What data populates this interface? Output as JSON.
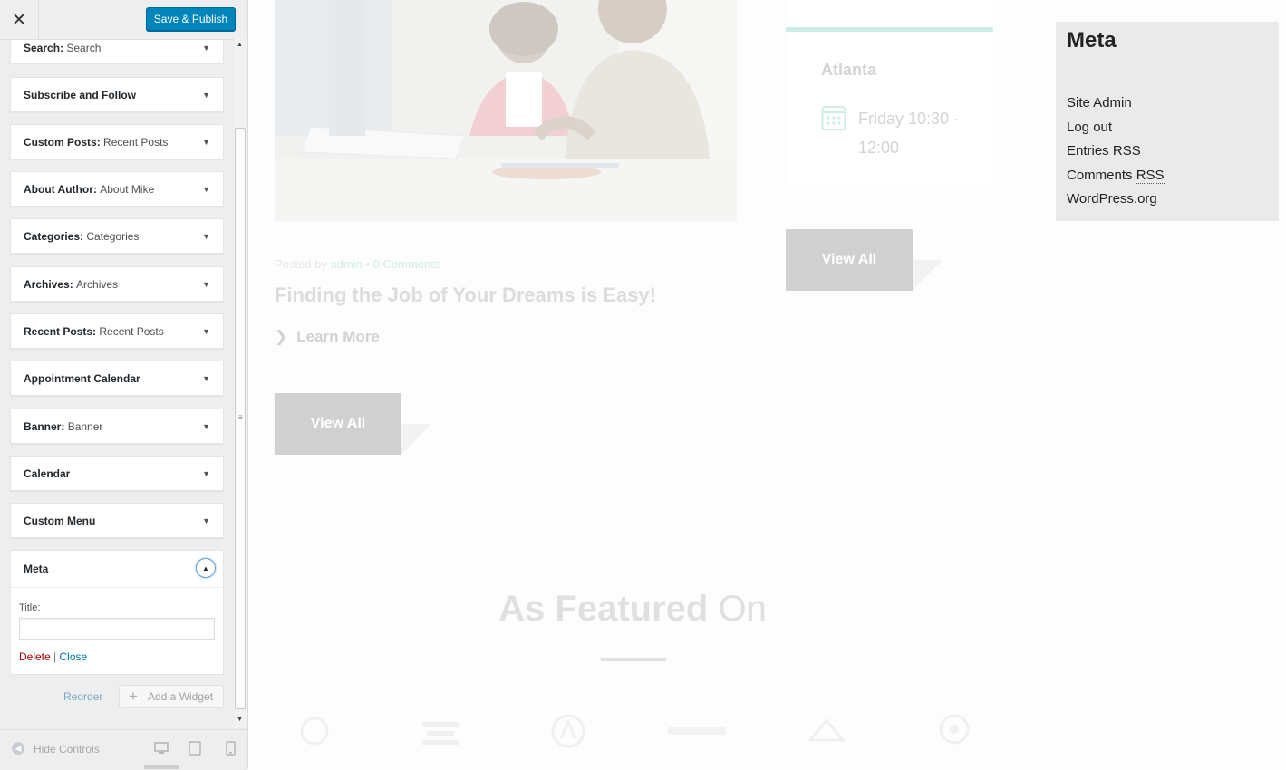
{
  "customizer": {
    "close_symbol": "✕",
    "save_button": "Save & Publish",
    "widgets": [
      {
        "name": "Search",
        "title": "Search"
      },
      {
        "name": "Subscribe and Follow",
        "title": ""
      },
      {
        "name": "Custom Posts",
        "title": "Recent Posts"
      },
      {
        "name": "About Author",
        "title": "About Mike"
      },
      {
        "name": "Categories",
        "title": "Categories"
      },
      {
        "name": "Archives",
        "title": "Archives"
      },
      {
        "name": "Recent Posts",
        "title": "Recent Posts"
      },
      {
        "name": "Appointment Calendar",
        "title": ""
      },
      {
        "name": "Banner",
        "title": "Banner"
      },
      {
        "name": "Calendar",
        "title": ""
      },
      {
        "name": "Custom Menu",
        "title": ""
      }
    ],
    "expanded_widget": {
      "name": "Meta",
      "field_label": "Title:",
      "field_value": "",
      "delete_label": "Delete",
      "separator": "|",
      "close_label": "Close"
    },
    "reorder_label": "Reorder",
    "add_widget_label": "Add a Widget",
    "hide_controls_label": "Hide Controls"
  },
  "preview": {
    "post": {
      "meta_prefix": "Posted by",
      "author": "admin",
      "dot": "•",
      "comments": "0 Comments",
      "title": "Finding the Job of Your Dreams is Easy!",
      "learn_more": "Learn More"
    },
    "view_all_label": "View All",
    "event": {
      "city": "Atlanta",
      "time": "Friday 10:30 - 12:00"
    },
    "meta_widget": {
      "title": "Meta",
      "links": [
        "Site Admin",
        "Log out",
        "Entries",
        "Comments",
        "WordPress.org"
      ],
      "rss": "RSS"
    },
    "featured": {
      "bold": "As Featured",
      "light": "On"
    }
  },
  "colors": {
    "accent": "#0085ba",
    "link": "#0073aa",
    "delete": "#aa0000",
    "teal": "#cdeee7"
  }
}
